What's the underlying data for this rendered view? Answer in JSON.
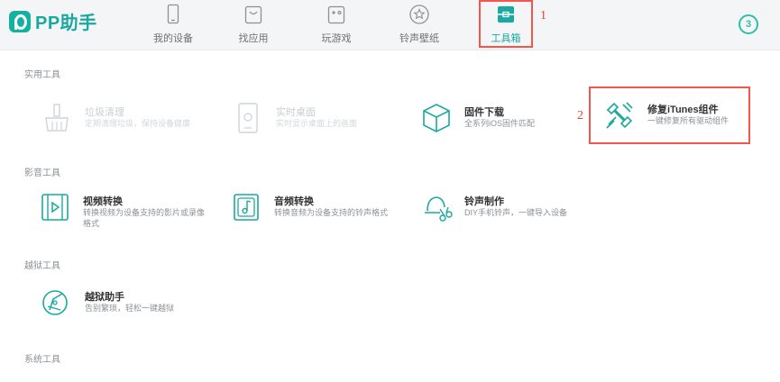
{
  "app": {
    "name": "PP助手"
  },
  "nav": [
    {
      "label": "我的设备",
      "icon": "phone-icon"
    },
    {
      "label": "找应用",
      "icon": "bag-icon"
    },
    {
      "label": "玩游戏",
      "icon": "gamepad-icon"
    },
    {
      "label": "铃声壁纸",
      "icon": "star-icon"
    },
    {
      "label": "工具箱",
      "icon": "toolbox-icon",
      "active": true
    }
  ],
  "notifications": {
    "count": "3"
  },
  "annotations": {
    "first": "1",
    "second": "2"
  },
  "sections": {
    "practical": "实用工具",
    "media": "影音工具",
    "jailbreak": "越狱工具",
    "system": "系统工具"
  },
  "tools": {
    "junk_clean": {
      "name": "垃圾清理",
      "desc": "定期清理垃圾，保持设备健康",
      "icon": "broom-icon"
    },
    "live_desktop": {
      "name": "实时桌面",
      "desc": "实时显示桌面上的画面",
      "icon": "monitor-icon"
    },
    "firmware": {
      "name": "固件下载",
      "desc": "全系列iOS固件匹配",
      "icon": "cube-icon"
    },
    "fix_itunes": {
      "name": "修复iTunes组件",
      "desc": "一键修复所有驱动组件",
      "icon": "wrench-icon"
    },
    "video": {
      "name": "视频转换",
      "desc": "转换视频为设备支持的影片或录像格式",
      "icon": "film-icon"
    },
    "audio": {
      "name": "音频转换",
      "desc": "转换音频为设备支持的铃声格式",
      "icon": "music-note-icon"
    },
    "ringtone": {
      "name": "铃声制作",
      "desc": "DIY手机铃声，一键导入设备",
      "icon": "bell-scissors-icon"
    },
    "jailbreak_helper": {
      "name": "越狱助手",
      "desc": "告别繁琐，轻松一键越狱",
      "icon": "compass-icon"
    }
  },
  "colors": {
    "accent": "#1aa9a0",
    "highlight": "#f4564c"
  }
}
